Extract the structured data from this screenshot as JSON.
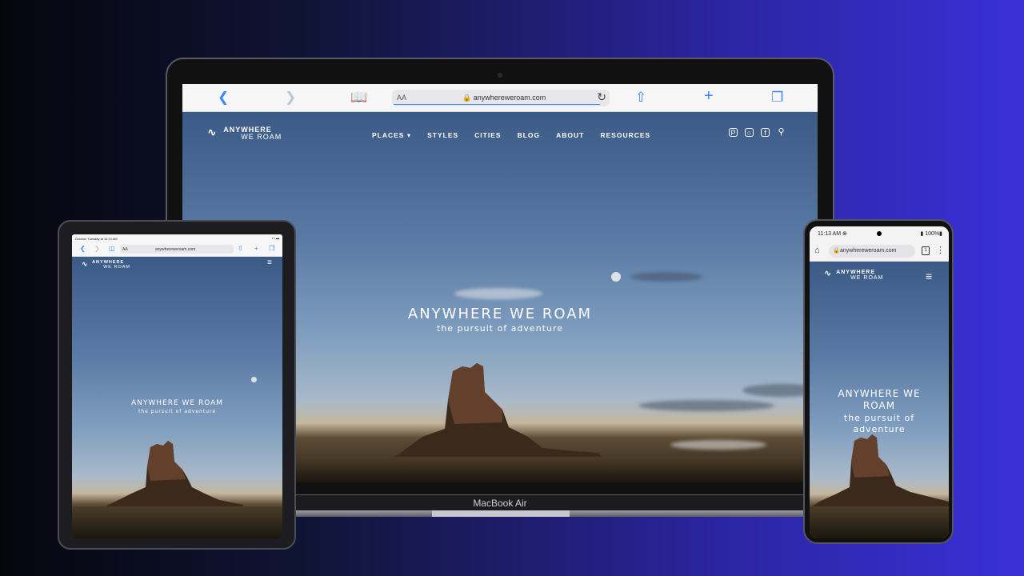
{
  "browser": {
    "url": "anywhereweroam.com",
    "aa_label": "AA",
    "icons": [
      "back-icon",
      "forward-icon",
      "bookmarks-icon",
      "lock-icon",
      "reload-icon",
      "share-icon",
      "new-tab-icon",
      "tabs-icon"
    ]
  },
  "site": {
    "logo_line1": "ANYWHERE",
    "logo_line2": "WE ROAM",
    "nav": [
      {
        "label": "PLACES ▾"
      },
      {
        "label": "STYLES"
      },
      {
        "label": "CITIES"
      },
      {
        "label": "BLOG"
      },
      {
        "label": "ABOUT"
      },
      {
        "label": "RESOURCES"
      }
    ],
    "social_icons": [
      "pinterest-icon",
      "instagram-icon",
      "facebook-icon",
      "search-icon"
    ],
    "hero_title": "ANYWHERE WE ROAM",
    "hero_subtitle": "the pursuit of adventure"
  },
  "laptop": {
    "label": "MacBook Air"
  },
  "tablet": {
    "status_time": "October Tuesday at 11:13 AM",
    "status_battery": "▪ ▪ ▬",
    "url": "anywhereweroam.com",
    "aa_label": "AA"
  },
  "phone": {
    "status_time": "11:13 AM ⊕",
    "status_battery": "▮ 100%▮",
    "url": "anywhereweroam.com",
    "tab_count": "1"
  },
  "colors": {
    "background_left": "#05060d",
    "background_right": "#3a30d8",
    "accent": "#3a86ff"
  }
}
